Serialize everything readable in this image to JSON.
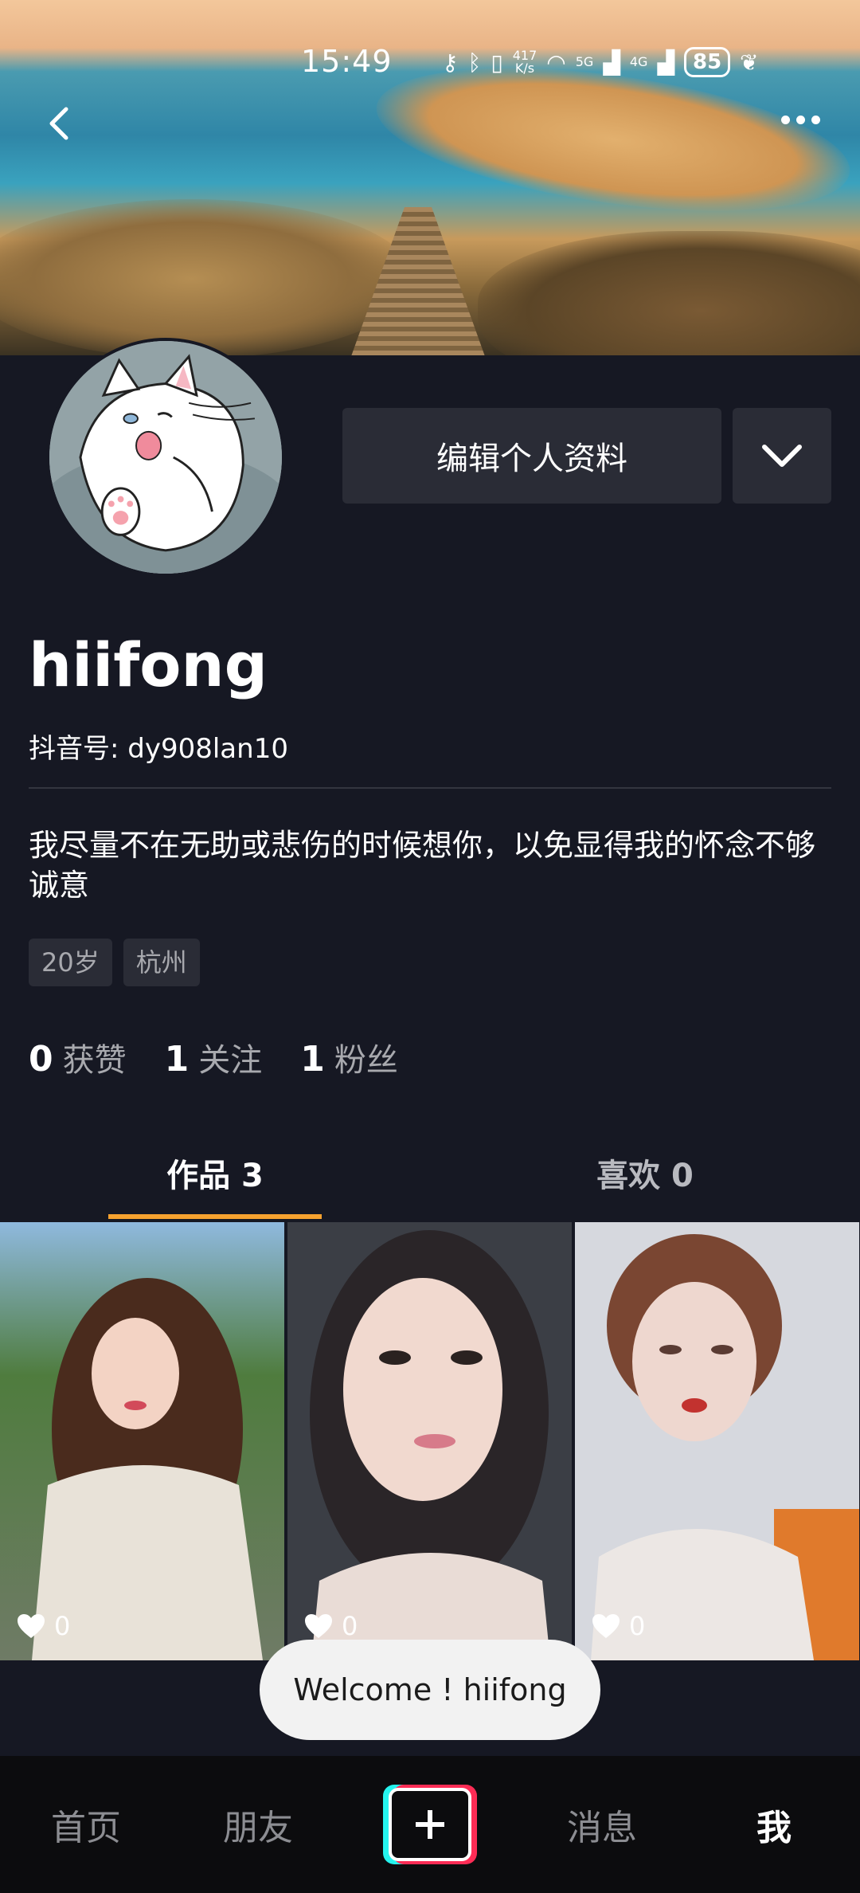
{
  "status_bar": {
    "time": "15:49",
    "net_speed_value": "417",
    "net_speed_unit": "K/s",
    "signal_5g": "5G",
    "signal_4g": "4G",
    "battery": "85"
  },
  "profile": {
    "username": "hiifong",
    "douyin_id": "抖音号: dy908lan10",
    "bio": "我尽量不在无助或悲伤的时候想你，以免显得我的怀念不够诚意",
    "tags": [
      "20岁",
      "杭州"
    ],
    "edit_button": "编辑个人资料"
  },
  "stats": [
    {
      "num": "0",
      "label": "获赞"
    },
    {
      "num": "1",
      "label": "关注"
    },
    {
      "num": "1",
      "label": "粉丝"
    }
  ],
  "tabs": [
    {
      "label": "作品 3",
      "active": true
    },
    {
      "label": "喜欢 0",
      "active": false
    }
  ],
  "videos": [
    {
      "likes": "0"
    },
    {
      "likes": "0"
    },
    {
      "likes": "0"
    }
  ],
  "toast": "Welcome ! hiifong",
  "bottom_nav": {
    "home": "首页",
    "friends": "朋友",
    "messages": "消息",
    "me": "我"
  },
  "colors": {
    "background": "#161823",
    "tab_accent": "#f6a22f",
    "plus_left": "#25f4ee",
    "plus_right": "#fe2c55"
  }
}
